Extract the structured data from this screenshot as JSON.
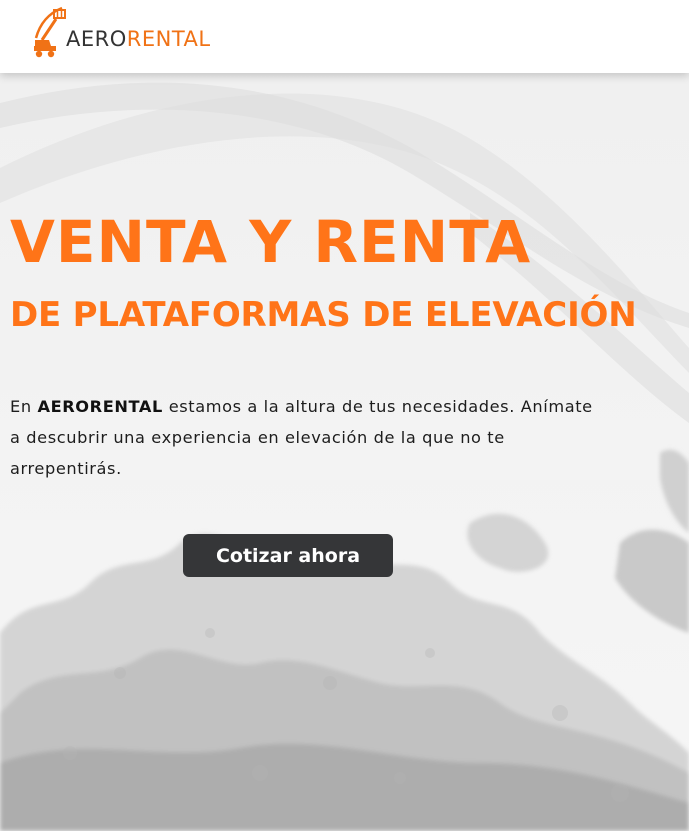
{
  "brand": {
    "logo_aero": "AERO",
    "logo_rental": "RENTAL",
    "accent_color": "#ff7418"
  },
  "hero": {
    "title_line1": "VENTA Y RENTA",
    "title_line2": "DE PLATAFORMAS DE ELEVACIÓN",
    "intro_prefix": "En ",
    "intro_brand": "AERORENTAL",
    "intro_rest": " estamos a la altura de tus necesidades. Anímate a descubrir una experiencia en elevación de la que no te arrepentirás.",
    "cta_label": "Cotizar ahora",
    "cta_color": "#353638"
  }
}
